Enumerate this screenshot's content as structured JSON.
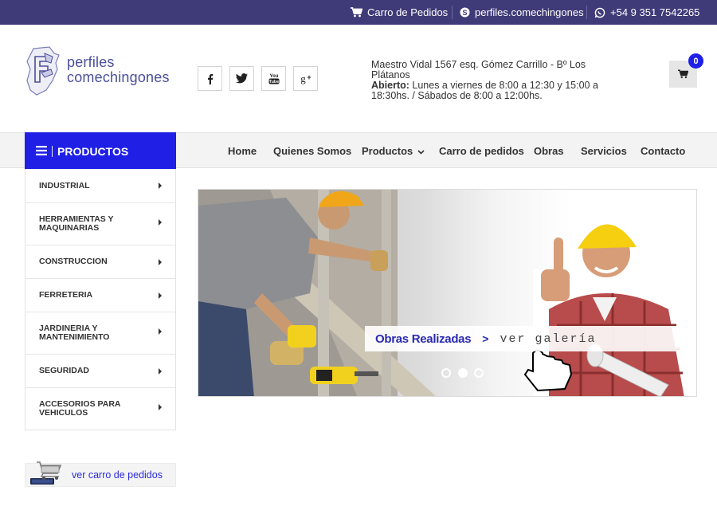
{
  "topbar": {
    "cart_label": "Carro de Pedidos",
    "skype_label": "perfiles.comechingones",
    "whatsapp_label": "+54 9 351 7542265"
  },
  "header": {
    "logo_line1": "perfiles",
    "logo_line2": "comechingones",
    "social": [
      "facebook-icon",
      "twitter-icon",
      "youtube-icon",
      "google-plus-icon"
    ],
    "address_line": "Maestro Vidal 1567 esq. Gómez Carrillo - Bº Los Plátanos",
    "hours_label": "Abierto:",
    "hours_text": "Lunes a viernes de 8:00 a 12:30 y 15:00 a 18:30hs. / Sábados de 8:00 a 12:00hs.",
    "cart_count": "0"
  },
  "nav": {
    "products_tab": "PRODUCTOS",
    "items": [
      "Home",
      "Quienes Somos",
      "Productos",
      "Carro de pedidos",
      "Obras",
      "Servicios",
      "Contacto"
    ]
  },
  "sidebar": {
    "categories": [
      {
        "line1": "INDUSTRIAL",
        "line2": ""
      },
      {
        "line1": "HERRAMIENTAS Y",
        "line2": "MAQUINARIAS"
      },
      {
        "line1": "CONSTRUCCION",
        "line2": ""
      },
      {
        "line1": "FERRETERIA",
        "line2": ""
      },
      {
        "line1": "JARDINERIA Y",
        "line2": "MANTENIMIENTO"
      },
      {
        "line1": "SEGURIDAD",
        "line2": ""
      },
      {
        "line1": "ACCESORIOS PARA",
        "line2": "VEHICULOS"
      }
    ],
    "cart_banner_label": "ver carro de pedidos"
  },
  "slider": {
    "caption_title": "Obras Realizadas",
    "caption_arrow": ">",
    "caption_link": "ver galería",
    "slide_count": 3,
    "active_slide": 2
  },
  "colors": {
    "topbar": "#3f3b78",
    "accent": "#1f1fe6",
    "logo": "#4b4f9a"
  }
}
